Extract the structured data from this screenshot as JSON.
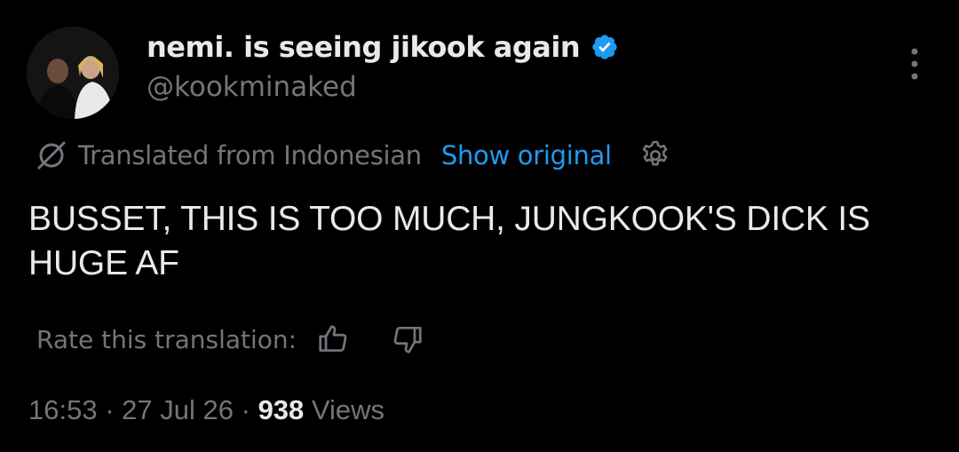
{
  "tweet": {
    "display_name": "nemi. is seeing jikook again",
    "handle": "@kookminaked",
    "verified": true,
    "translation": {
      "label": "Translated from Indonesian",
      "show_original": "Show original"
    },
    "text": "BUSSET, THIS IS TOO MUCH, JUNGKOOK'S DICK IS HUGE AF",
    "rate_label": "Rate this translation:",
    "time": "16:53",
    "date": "27 Jul 26",
    "separator": "·",
    "views_count": "938",
    "views_label": "Views"
  },
  "icons": {
    "verified": "verified-badge-icon",
    "more": "more-vertical-icon",
    "translate": "translate-icon",
    "settings": "gear-icon",
    "thumbs_up": "thumbs-up-icon",
    "thumbs_down": "thumbs-down-icon"
  },
  "colors": {
    "background": "#000000",
    "text": "#e7e9ea",
    "muted": "#71767b",
    "accent": "#1d9bf0"
  }
}
